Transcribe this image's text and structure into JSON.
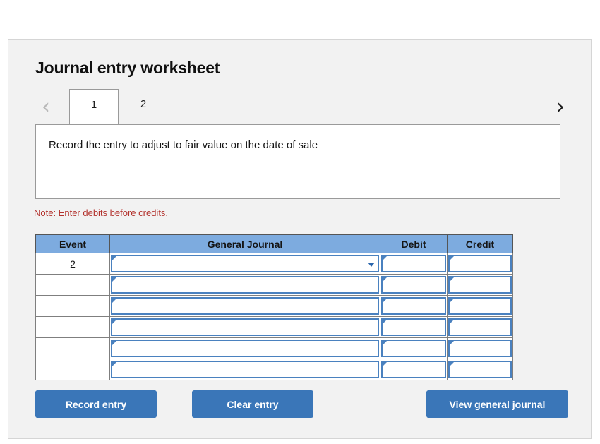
{
  "page": {
    "title": "Journal entry worksheet"
  },
  "nav": {
    "prev_icon": "chevron-left-icon",
    "prev_glyph": "‹",
    "next_icon": "chevron-right-icon",
    "next_glyph": "›"
  },
  "tabs": [
    {
      "label": "1",
      "active": true
    },
    {
      "label": "2",
      "active": false
    }
  ],
  "prompt": {
    "text": "Record the entry to adjust to fair value on the date of sale"
  },
  "note": {
    "text": "Note: Enter debits before credits."
  },
  "table": {
    "headers": [
      "Event",
      "General Journal",
      "Debit",
      "Credit"
    ],
    "rows": [
      {
        "event": "2",
        "general_journal": "",
        "debit": "",
        "credit": "",
        "has_dropdown": true
      },
      {
        "event": "",
        "general_journal": "",
        "debit": "",
        "credit": "",
        "has_dropdown": false
      },
      {
        "event": "",
        "general_journal": "",
        "debit": "",
        "credit": "",
        "has_dropdown": false
      },
      {
        "event": "",
        "general_journal": "",
        "debit": "",
        "credit": "",
        "has_dropdown": false
      },
      {
        "event": "",
        "general_journal": "",
        "debit": "",
        "credit": "",
        "has_dropdown": false
      },
      {
        "event": "",
        "general_journal": "",
        "debit": "",
        "credit": "",
        "has_dropdown": false
      }
    ]
  },
  "buttons": {
    "record": "Record entry",
    "clear": "Clear entry",
    "view": "View general journal"
  },
  "colors": {
    "panel_bg": "#f2f2f2",
    "header_blue": "#7dabdf",
    "button_blue": "#3a76b8",
    "note_red": "#b3332e",
    "input_border_blue": "#4a81bf"
  }
}
